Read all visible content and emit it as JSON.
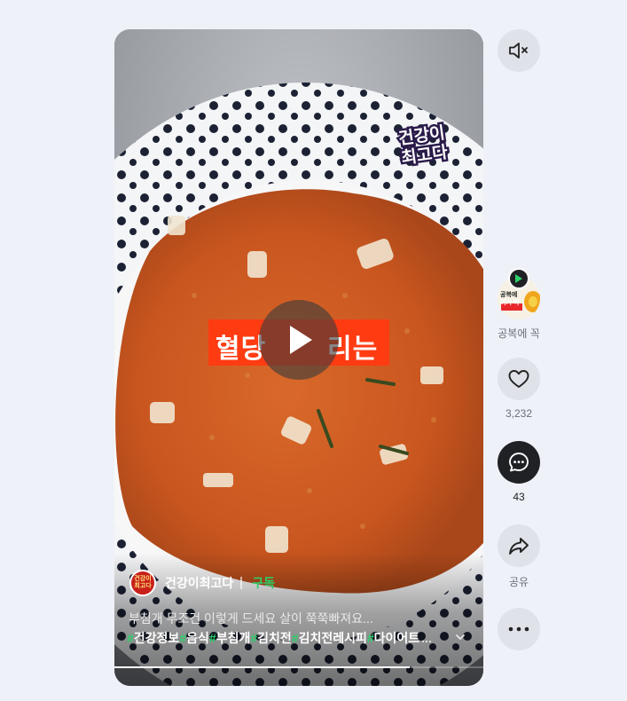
{
  "video": {
    "sticker_line1": "건강이",
    "sticker_line2": "최고다",
    "caption_left": "혈당",
    "caption_right": "리는",
    "progress_fraction": 0.8
  },
  "channel": {
    "avatar_line1": "건강이",
    "avatar_line2": "최고다",
    "name": "건강이최고다",
    "subscribe_label": "구독"
  },
  "description": "부침개 무조건 이렇게 드세요 살이 쭉쭉빠져요...",
  "hashtags": [
    {
      "hash": "#",
      "text": "건강정보"
    },
    {
      "hash": "#",
      "text": "음식"
    },
    {
      "hash": "#",
      "text": "부침개"
    },
    {
      "hash": "#",
      "text": "김치전"
    },
    {
      "hash": "#",
      "text": "김치전레시피"
    },
    {
      "hash": "#",
      "text": "다이어트"
    }
  ],
  "hashtags_more": "...",
  "side": {
    "mute_icon": "volume-mute-icon",
    "next_video_label": "공복에 꼭",
    "next_thumb_line1": "공복에",
    "next_thumb_line2": "이거 먹",
    "like_count": "3,232",
    "comment_count": "43",
    "share_label": "공유",
    "more_icon": "more-horizontal-icon"
  },
  "colors": {
    "accent_green": "#2bd16a",
    "caption_red": "#ff3b12",
    "page_bg": "#eef1f8"
  }
}
